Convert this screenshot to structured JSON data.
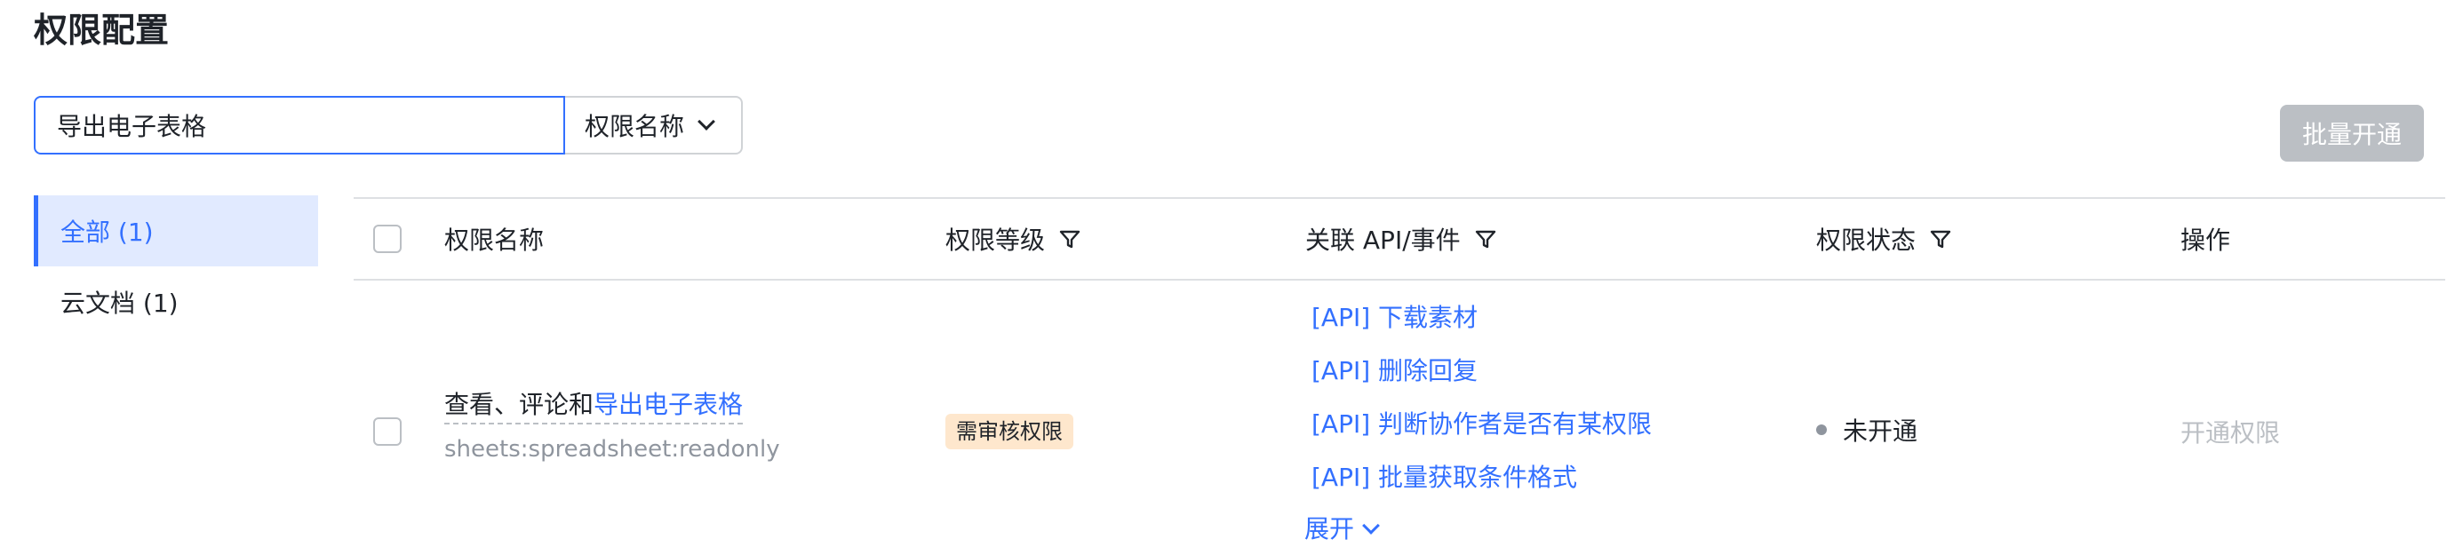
{
  "page": {
    "title": "权限配置"
  },
  "search": {
    "value": "导出电子表格",
    "field_selected": "权限名称"
  },
  "toolbar": {
    "batch_label": "批量开通"
  },
  "sidebar": {
    "items": [
      {
        "label": "全部 (1)",
        "active": true
      },
      {
        "label": "云文档 (1)",
        "active": false
      }
    ]
  },
  "table": {
    "columns": [
      "权限名称",
      "权限等级",
      "关联 API/事件",
      "权限状态",
      "操作"
    ],
    "rows": [
      {
        "name_prefix": "查看、评论和",
        "name_link": "导出电子表格",
        "code": "sheets:spreadsheet:readonly",
        "level": "需审核权限",
        "apis": [
          "[API] 下载素材",
          "[API] 删除回复",
          "[API] 判断协作者是否有某权限",
          "[API] 批量获取条件格式"
        ],
        "expand_label": "展开",
        "status": "未开通",
        "action": "开通权限"
      }
    ]
  },
  "colors": {
    "accent": "#3370ff",
    "badge_bg": "#fee7cd",
    "disabled": "#bbbfc4",
    "sidebar_active_bg": "#e1eaff"
  }
}
